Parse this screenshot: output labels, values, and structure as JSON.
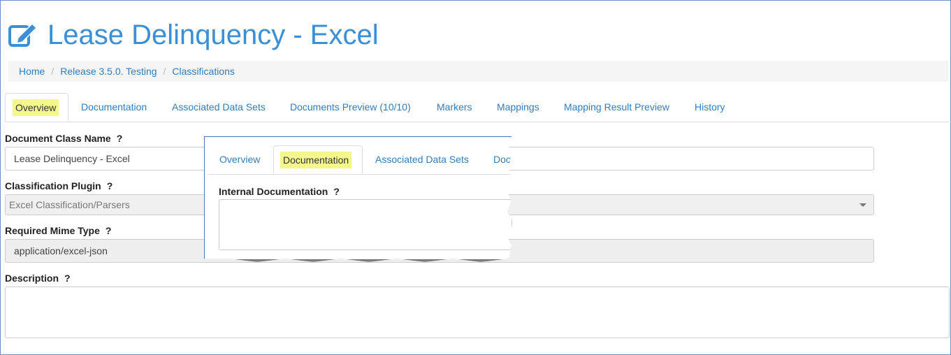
{
  "page": {
    "title": "Lease Delinquency - Excel",
    "title_icon": "edit-icon",
    "accent_color": "#3a8fd6"
  },
  "breadcrumb": [
    "Home",
    "Release 3.5.0. Testing",
    "Classifications"
  ],
  "tabs": [
    {
      "label": "Overview",
      "active": true
    },
    {
      "label": "Documentation"
    },
    {
      "label": "Associated Data Sets"
    },
    {
      "label": "Documents Preview (10/10)"
    },
    {
      "label": "Markers"
    },
    {
      "label": "Mappings"
    },
    {
      "label": "Mapping Result Preview"
    },
    {
      "label": "History"
    }
  ],
  "form": {
    "doc_class_label": "Document Class Name",
    "doc_class_value": "Lease Delinquency - Excel",
    "plugin_label": "Classification Plugin",
    "plugin_value": "Excel Classification/Parsers",
    "mime_label": "Required Mime Type",
    "mime_value": "application/excel-json",
    "description_label": "Description",
    "help_mark": "?"
  },
  "callout": {
    "tabs": [
      "Overview",
      "Documentation",
      "Associated Data Sets",
      "Doc"
    ],
    "active_tab": "Documentation",
    "field_label": "Internal Documentation",
    "help_mark": "?"
  },
  "highlight_color": "#f4f78a"
}
